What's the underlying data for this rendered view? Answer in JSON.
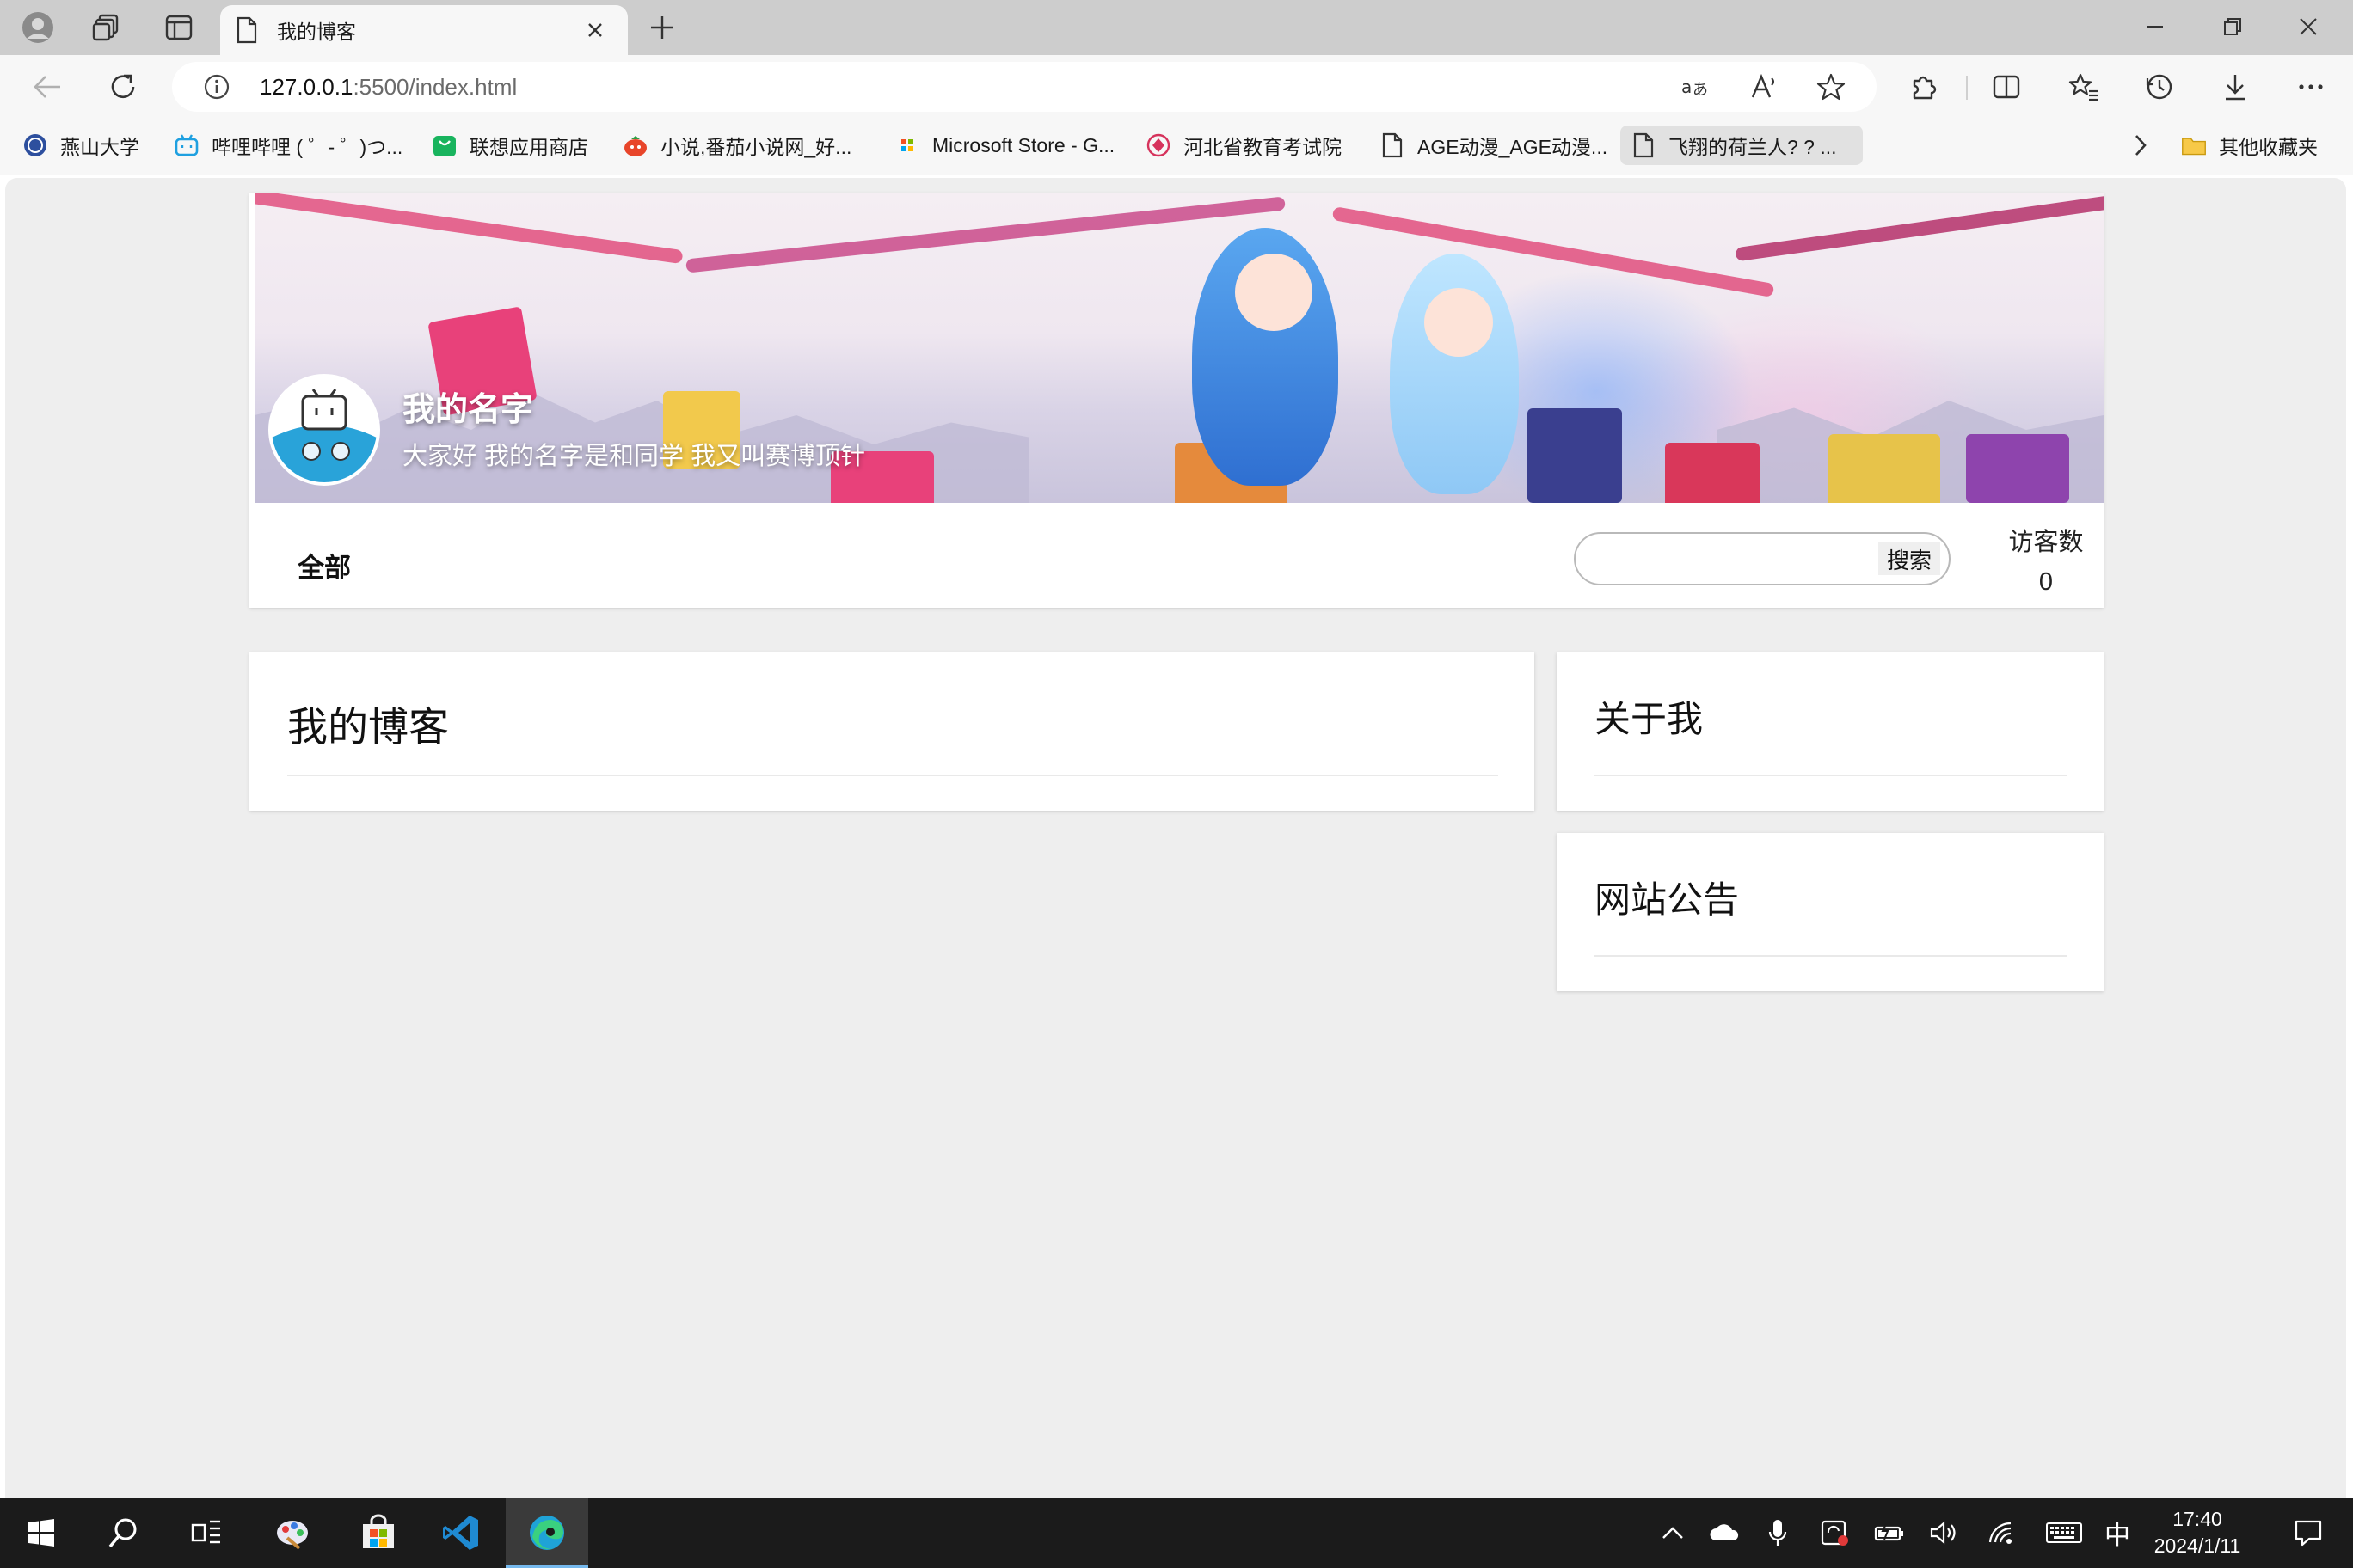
{
  "browser": {
    "tab": {
      "title": "我的博客"
    },
    "address": {
      "url_host": "127.0.0.1",
      "url_path": ":5500/index.html"
    },
    "bookmarks": [
      {
        "label": "燕山大学",
        "icon": "yanshan-university-icon"
      },
      {
        "label": "哔哩哔哩 ( ゜- ゜)つ...",
        "icon": "bilibili-icon"
      },
      {
        "label": "联想应用商店",
        "icon": "lenovo-store-icon"
      },
      {
        "label": "小说,番茄小说网_好...",
        "icon": "fanqie-novel-icon"
      },
      {
        "label": "Microsoft Store - G...",
        "icon": "microsoft-store-icon"
      },
      {
        "label": "河北省教育考试院",
        "icon": "hebei-exam-icon"
      },
      {
        "label": "AGE动漫_AGE动漫...",
        "icon": "page-icon"
      },
      {
        "label": "飞翔的荷兰人? ? ...",
        "icon": "page-icon"
      }
    ],
    "other_bookmarks": "其他收藏夹"
  },
  "page": {
    "header": {
      "site_name": "我的名字",
      "site_desc": "大家好 我的名字是和同学 我又叫赛博顶针"
    },
    "nav": {
      "all": "全部"
    },
    "search": {
      "button": "搜索",
      "value": ""
    },
    "visitors": {
      "label": "访客数",
      "count": "0"
    },
    "main_card": {
      "title": "我的博客"
    },
    "sidebar": {
      "about": {
        "title": "关于我"
      },
      "notice": {
        "title": "网站公告"
      }
    }
  },
  "taskbar": {
    "ime": "中",
    "time": "17:40",
    "date": "2024/1/11"
  },
  "colors": {
    "page_bg": "#eeeeee",
    "taskbar_bg": "#1b1b1b",
    "accent_active": "#76b9ed"
  }
}
